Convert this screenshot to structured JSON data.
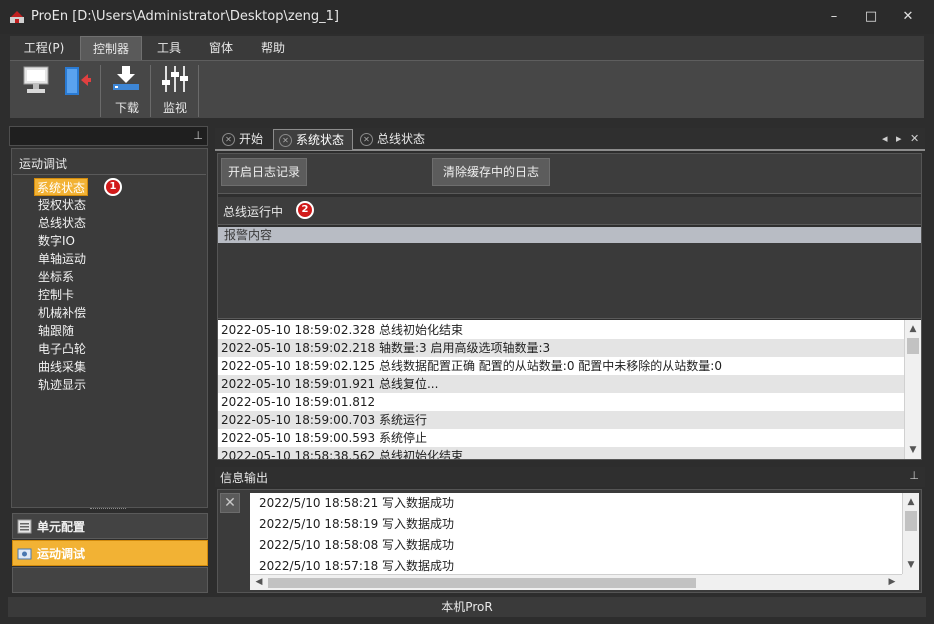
{
  "window": {
    "title": "ProEn [D:\\Users\\Administrator\\Desktop\\zeng_1]",
    "minimize_glyph": "–",
    "maximize_glyph": "□",
    "close_glyph": "✕"
  },
  "menu": {
    "items": [
      {
        "label": "工程(P)"
      },
      {
        "label": "控制器",
        "active": true
      },
      {
        "label": "工具"
      },
      {
        "label": "窗体"
      },
      {
        "label": "帮助"
      }
    ]
  },
  "toolbar": {
    "download_label": "下载",
    "monitor_label": "监视",
    "icons": [
      "computer-icon",
      "exit-door-icon",
      "download-icon",
      "sliders-icon"
    ]
  },
  "left_panel": {
    "pin_glyph": "⊥",
    "section_title": "运动调试",
    "items": [
      {
        "label": "系统状态",
        "selected": true
      },
      {
        "label": "授权状态"
      },
      {
        "label": "总线状态"
      },
      {
        "label": "数字IO"
      },
      {
        "label": "单轴运动"
      },
      {
        "label": "坐标系"
      },
      {
        "label": "控制卡"
      },
      {
        "label": "机械补偿"
      },
      {
        "label": "轴跟随"
      },
      {
        "label": "电子凸轮"
      },
      {
        "label": "曲线采集"
      },
      {
        "label": "轨迹显示"
      }
    ],
    "badge_1": "1",
    "nav_unit_label": "单元配置",
    "nav_motion_label": "运动调试"
  },
  "tabs": {
    "items": [
      {
        "label": "开始"
      },
      {
        "label": "系统状态",
        "active": true
      },
      {
        "label": "总线状态"
      }
    ],
    "close_glyph": "✕",
    "ctrl_left": "◂",
    "ctrl_right": "▸",
    "ctrl_close": "✕"
  },
  "system_status": {
    "start_log_button": "开启日志记录",
    "clear_log_button": "清除缓存中的日志",
    "bus_status_text": "总线运行中",
    "badge_2": "2",
    "alarm_header": "报警内容",
    "log_rows": [
      "2022-05-10  18:59:02.328  总线初始化结束",
      "2022-05-10  18:59:02.218  轴数量:3 启用高级选项轴数量:3",
      "2022-05-10  18:59:02.125  总线数据配置正确 配置的从站数量:0 配置中未移除的从站数量:0",
      "2022-05-10  18:59:01.921  总线复位...",
      "2022-05-10  18:59:01.812",
      "2022-05-10  18:59:00.703  系统运行",
      "2022-05-10  18:59:00.593  系统停止",
      "2022-05-10  18:58:38.562  总线初始化结束"
    ]
  },
  "info_output": {
    "title": "信息输出",
    "pin_glyph": "⊥",
    "clear_glyph": "✕",
    "rows": [
      "2022/5/10  18:58:21 写入数据成功",
      "2022/5/10  18:58:19 写入数据成功",
      "2022/5/10  18:58:08 写入数据成功",
      "2022/5/10  18:57:18 写入数据成功"
    ]
  },
  "statusbar": {
    "text": "本机ProR"
  },
  "colors": {
    "accent": "#f2b234",
    "badge": "#d11a1a"
  }
}
